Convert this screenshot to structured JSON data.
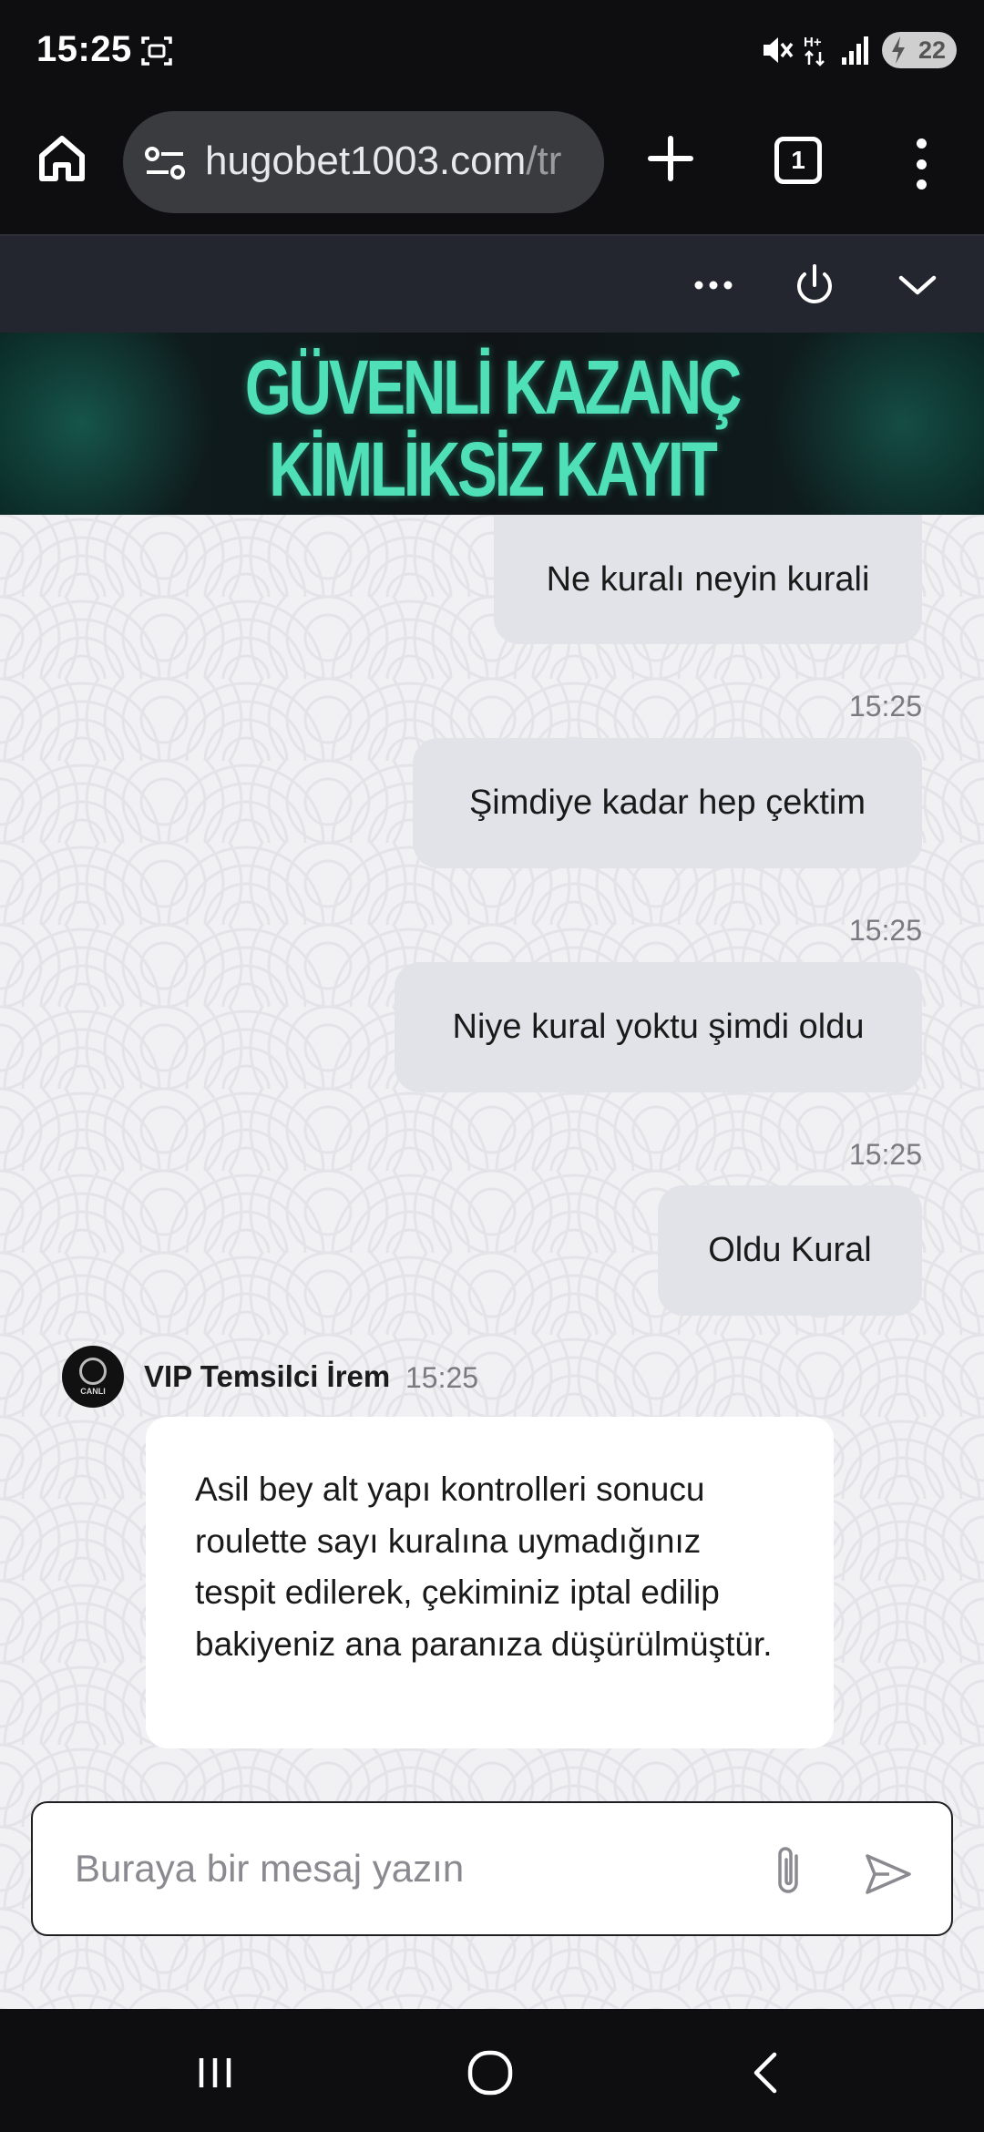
{
  "status_bar": {
    "time": "15:25",
    "battery_level": "22",
    "icons": [
      "screen-record-icon",
      "mute-icon",
      "network-hplus-icon",
      "signal-icon",
      "battery-charging-icon"
    ]
  },
  "browser": {
    "url_main": "hugobet1003.com",
    "url_rest": "/tr",
    "tab_count": "1",
    "icons": [
      "home-icon",
      "site-settings-icon",
      "new-tab-plus-icon",
      "tab-switcher-icon",
      "overflow-menu-icon"
    ]
  },
  "site_toolbar": {
    "icons": [
      "more-dots-icon",
      "power-icon",
      "chevron-down-icon"
    ]
  },
  "banner": {
    "line1": "GÜVENLİ KAZANÇ",
    "line2": "KİMLİKSİZ KAYIT"
  },
  "messages": [
    {
      "text": "Ne kuralı neyin kurali",
      "time": "15:25"
    },
    {
      "text": "Şimdiye kadar hep çektim",
      "time": "15:25"
    },
    {
      "text": "Niye kural yoktu şimdi oldu",
      "time": "15:25"
    },
    {
      "text": "Oldu Kural",
      "time": ""
    }
  ],
  "agent": {
    "name": "VIP Temsilci İrem",
    "time": "15:25",
    "avatar_text": "CANLI",
    "message": "Asil bey alt yapı kontrolleri sonucu roulette sayı kuralına uymadığınız tespit edilerek, çekiminiz iptal edilip bakiyeniz ana paranıza düşürülmüştür."
  },
  "composer": {
    "placeholder": "Buraya bir mesaj yazın",
    "icons": [
      "attach-paperclip-icon",
      "send-icon"
    ]
  },
  "nav_bar": {
    "icons": [
      "recent-apps-icon",
      "home-circle-icon",
      "back-icon"
    ]
  },
  "colors": {
    "chrome_bg": "#0e0e10",
    "url_pill": "#3a3b3f",
    "site_bar": "#23262e",
    "banner_text": "#4fe0b8",
    "user_bubble": "#e2e3e8",
    "agent_bubble": "#ffffff",
    "chat_bg": "#f1f1f3"
  }
}
